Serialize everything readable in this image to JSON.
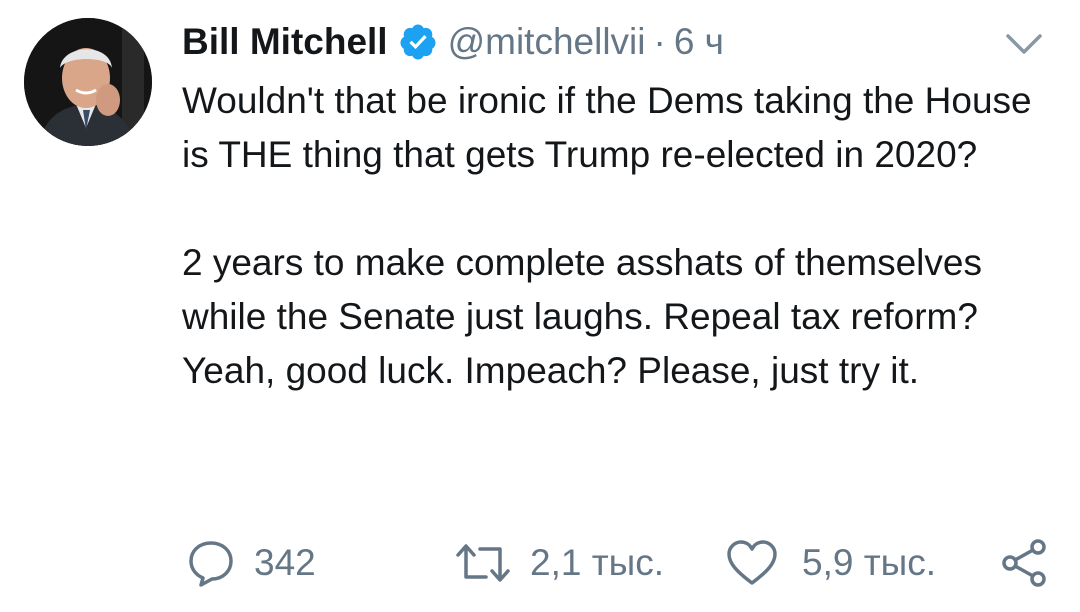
{
  "tweet": {
    "author_name": "Bill Mitchell",
    "handle": "@mitchellvii",
    "separator": "·",
    "time": "6 ч",
    "paragraphs": [
      "Wouldn't that be ironic if the Dems taking the House is THE thing that gets Trump re-elected in 2020?",
      "2 years to make complete asshats of themselves while the Senate just laughs. Repeal tax reform?  Yeah, good luck. Impeach?  Please, just try it."
    ]
  },
  "actions": {
    "reply_count": "342",
    "retweet_count": "2,1 тыс.",
    "like_count": "5,9 тыс."
  },
  "colors": {
    "text": "#14171a",
    "secondary": "#657786",
    "verified_blue": "#1da1f2"
  },
  "icons": [
    "verified-badge-icon",
    "chevron-down-icon",
    "reply-icon",
    "retweet-icon",
    "like-icon",
    "share-icon"
  ]
}
